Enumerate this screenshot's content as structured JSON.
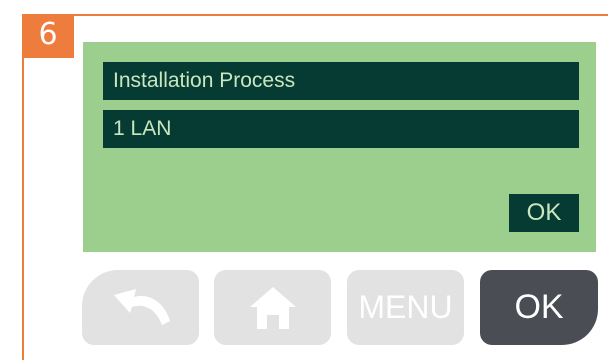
{
  "step": {
    "number": "6"
  },
  "screen": {
    "title": "Installation Process",
    "value": "1 LAN",
    "ok_label": "OK"
  },
  "buttons": {
    "back_icon": "back-arrow-icon",
    "home_icon": "home-icon",
    "menu_label": "MENU",
    "ok_label": "OK"
  },
  "colors": {
    "accent": "#ee7c3c",
    "screen_bg": "#9ccf8e",
    "row_bg": "#053b33",
    "row_text": "#c9e6bf",
    "button_light": "#e2e2e2",
    "button_dark": "#4a4d53"
  }
}
